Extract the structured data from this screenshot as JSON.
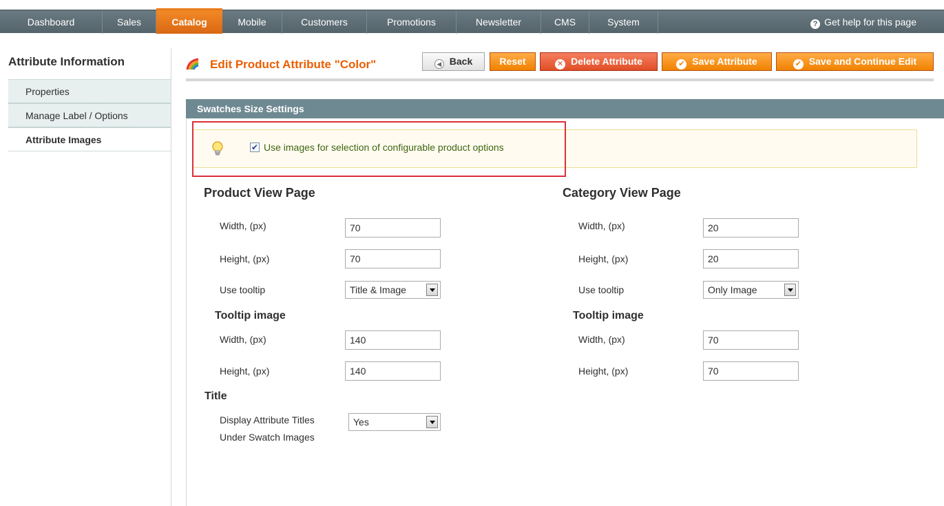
{
  "nav": {
    "items": [
      "Dashboard",
      "Sales",
      "Catalog",
      "Mobile",
      "Customers",
      "Promotions",
      "Newsletter",
      "CMS",
      "System"
    ],
    "active": "Catalog",
    "help": "Get help for this page"
  },
  "sidebar": {
    "title": "Attribute Information",
    "items": [
      "Properties",
      "Manage Label / Options",
      "Attribute Images"
    ],
    "active": "Attribute Images"
  },
  "header": {
    "title": "Edit Product Attribute \"Color\"",
    "buttons": {
      "back": "Back",
      "reset": "Reset",
      "delete": "Delete Attribute",
      "save": "Save Attribute",
      "save_continue": "Save and Continue Edit"
    }
  },
  "section": {
    "title": "Swatches Size Settings",
    "notice": {
      "checked": true,
      "label": "Use images for selection of configurable product options"
    }
  },
  "product_view": {
    "title": "Product View Page",
    "width_label": "Width, (px)",
    "width": "70",
    "height_label": "Height, (px)",
    "height": "70",
    "tooltip_label": "Use tooltip",
    "tooltip": "Title & Image",
    "tooltip_image_title": "Tooltip image",
    "tt_width_label": "Width, (px)",
    "tt_width": "140",
    "tt_height_label": "Height, (px)",
    "tt_height": "140",
    "title_section": "Title",
    "display_titles_label_1": "Display Attribute Titles",
    "display_titles_label_2": "Under Swatch Images",
    "display_titles": "Yes"
  },
  "category_view": {
    "title": "Category View Page",
    "width_label": "Width, (px)",
    "width": "20",
    "height_label": "Height, (px)",
    "height": "20",
    "tooltip_label": "Use tooltip",
    "tooltip": "Only Image",
    "tooltip_image_title": "Tooltip image",
    "tt_width_label": "Width, (px)",
    "tt_width": "70",
    "tt_height_label": "Height, (px)",
    "tt_height": "70"
  },
  "colors": {
    "accent": "#eb5e00",
    "button_orange": "#f18200",
    "button_delete": "#e04e26",
    "section_header": "#6f8992",
    "highlight_box": "#d9303a"
  }
}
